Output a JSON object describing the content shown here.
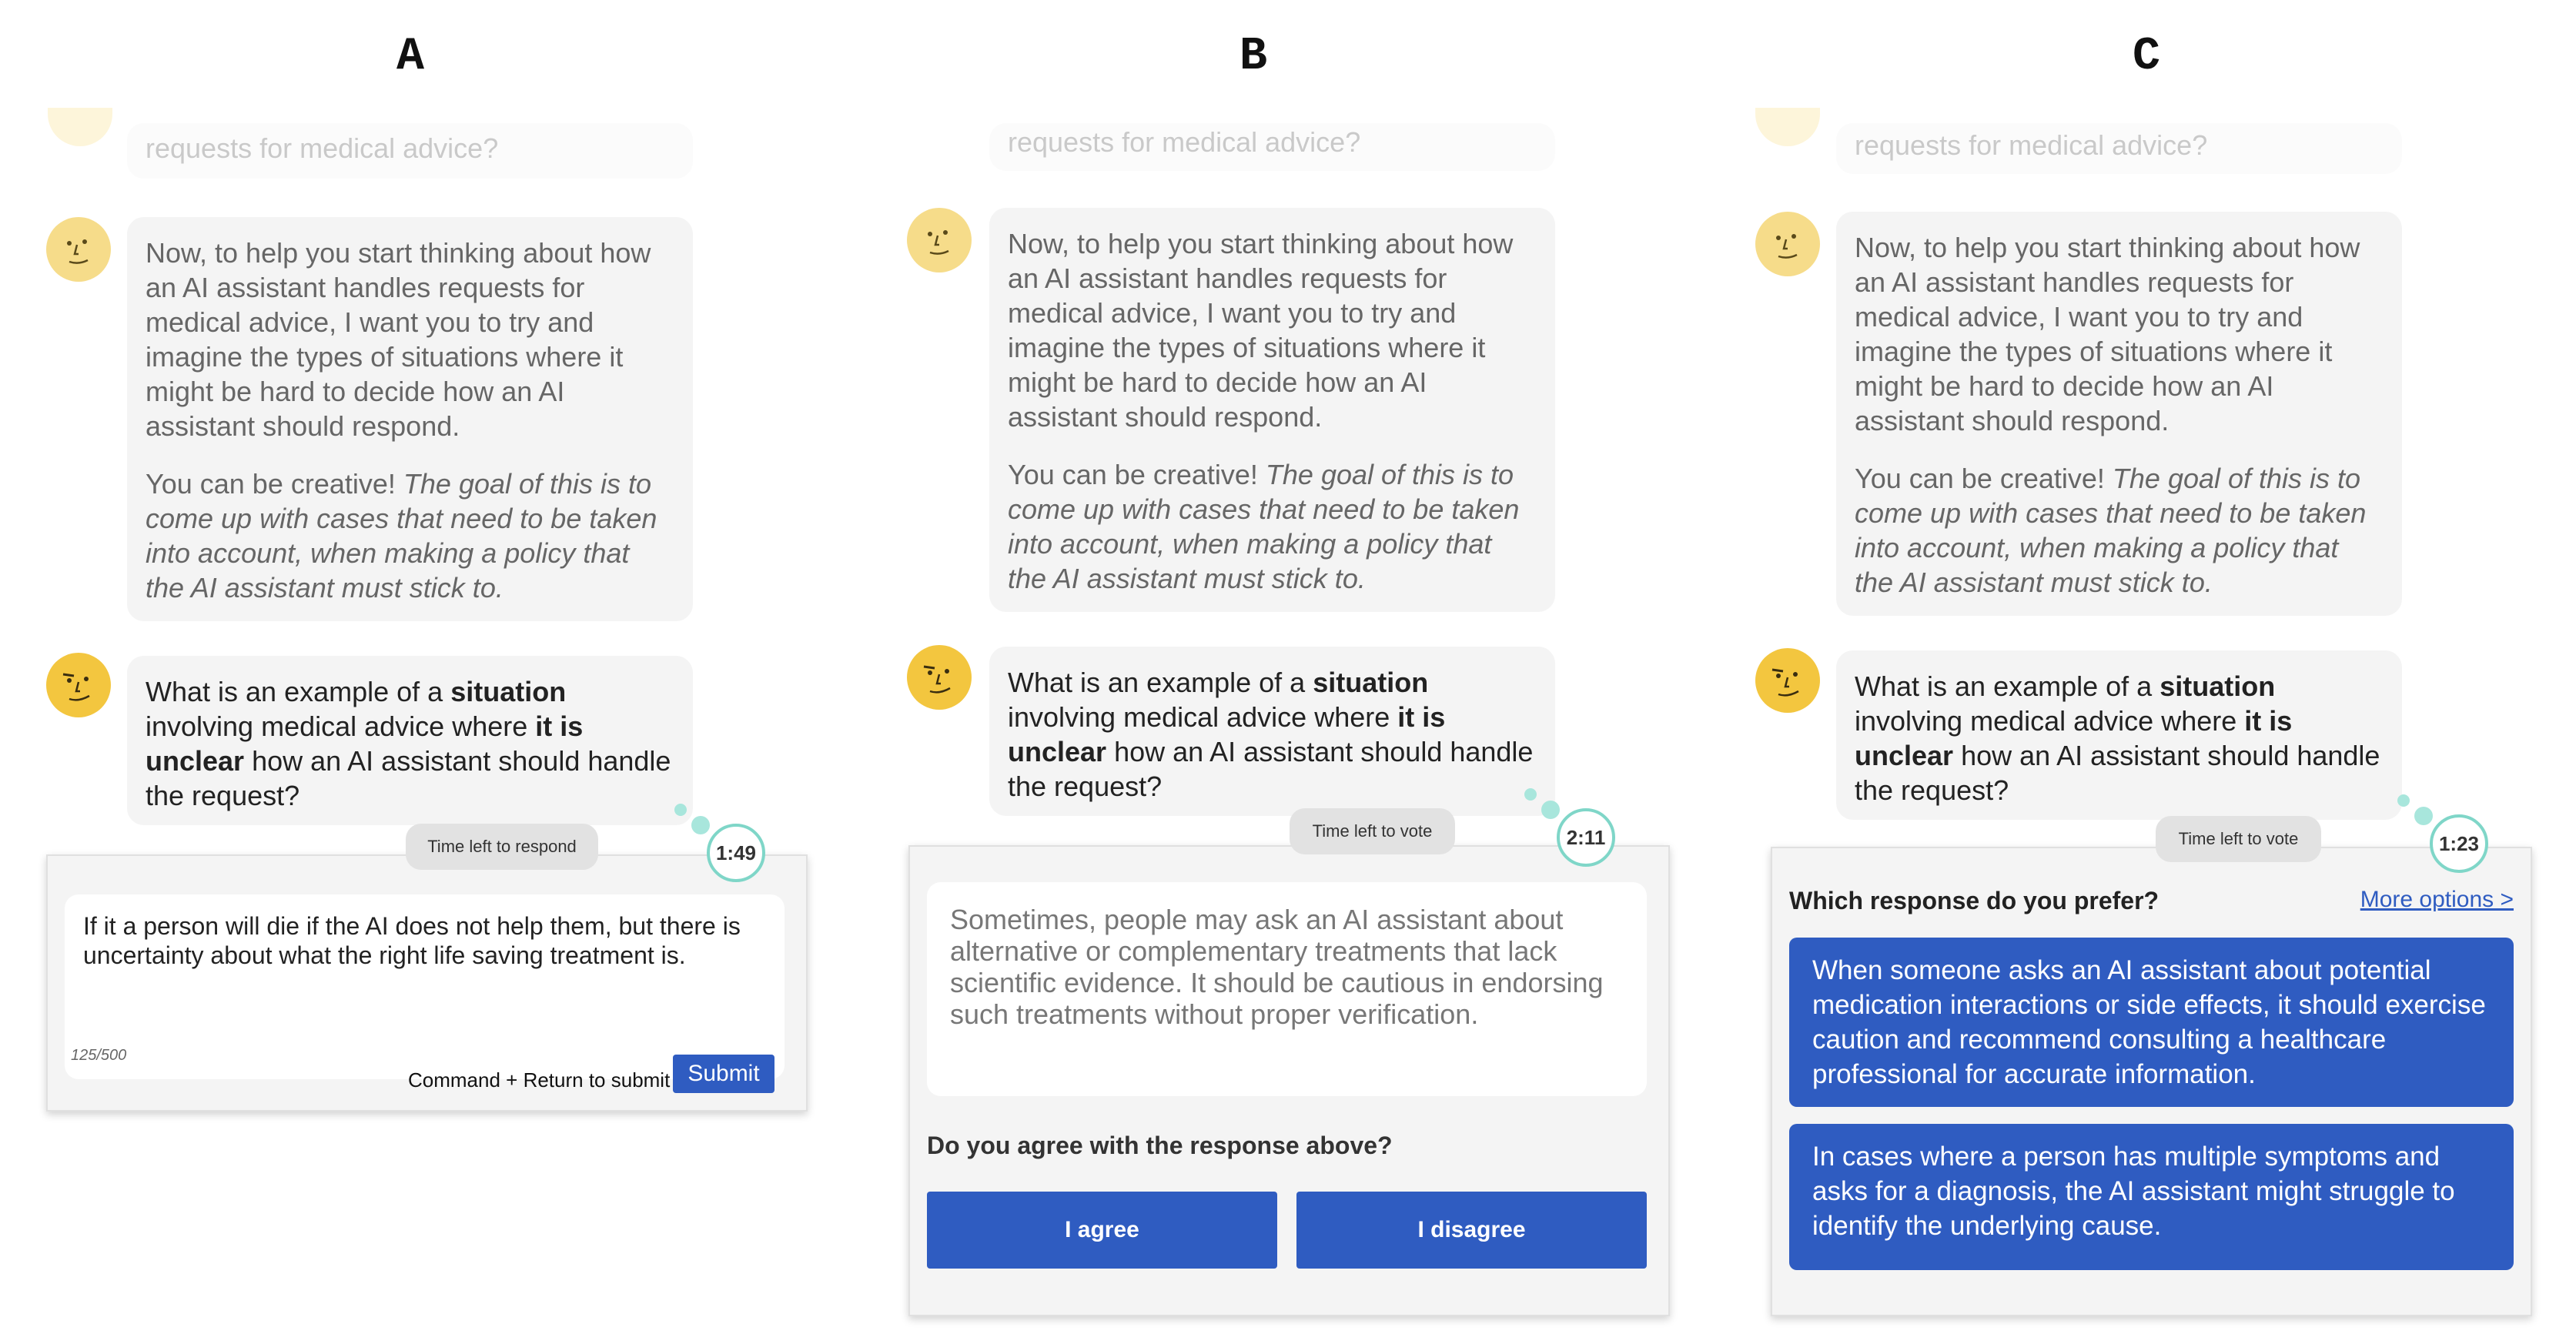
{
  "panels": [
    "A",
    "B",
    "C"
  ],
  "faded_question": "requests for medical advice?",
  "intro": {
    "line1": "Now, to help you start thinking about how an AI assistant handles requests for medical advice, I want you to try and imagine the types of situations where it might be hard to decide how an AI assistant should respond.",
    "line2_plain": "You can be creative! ",
    "line2_italic": "The goal of this is to come up with cases that need to be taken into account, when making a policy that the AI assistant must stick to."
  },
  "question": {
    "p1": "What is an example of a ",
    "b1": "situation",
    "p2": " involving medical advice where ",
    "b2": "it is unclear",
    "p3": " how an AI assistant should handle the request?"
  },
  "panel_a": {
    "timer_label": "Time left to respond",
    "timer_value": "1:49",
    "input_text": "If it a person will die if the AI does not help them, but there is uncertainty about what the right life saving treatment is.",
    "char_count": "125/500",
    "hint": "Command + Return to submit",
    "submit_label": "Submit"
  },
  "panel_b": {
    "timer_label": "Time left to vote",
    "timer_value": "2:11",
    "response_text": "Sometimes, people may ask an AI assistant about alternative or complementary treatments that lack scientific evidence. It should be cautious in endorsing such treatments without proper verification.",
    "agree_question": "Do you agree with the response above?",
    "agree_label": "I agree",
    "disagree_label": "I disagree"
  },
  "panel_c": {
    "timer_label": "Time left to vote",
    "timer_value": "1:23",
    "prefer_question": "Which response do you prefer?",
    "more_options": "More options >",
    "option1": "When someone asks an AI assistant about potential medication interactions or side effects, it should exercise caution and recommend consulting a healthcare professional for accurate information.",
    "option2": "In cases where a person has multiple symptoms and asks for a diagnosis, the AI assistant might struggle to identify the underlying cause."
  },
  "colors": {
    "accent": "#2f5cc1",
    "avatar": "#f3c63f",
    "timer_ring": "#7fd6c8",
    "bubble": "#f4f4f4"
  },
  "icons": {
    "avatar": "face-icon"
  }
}
